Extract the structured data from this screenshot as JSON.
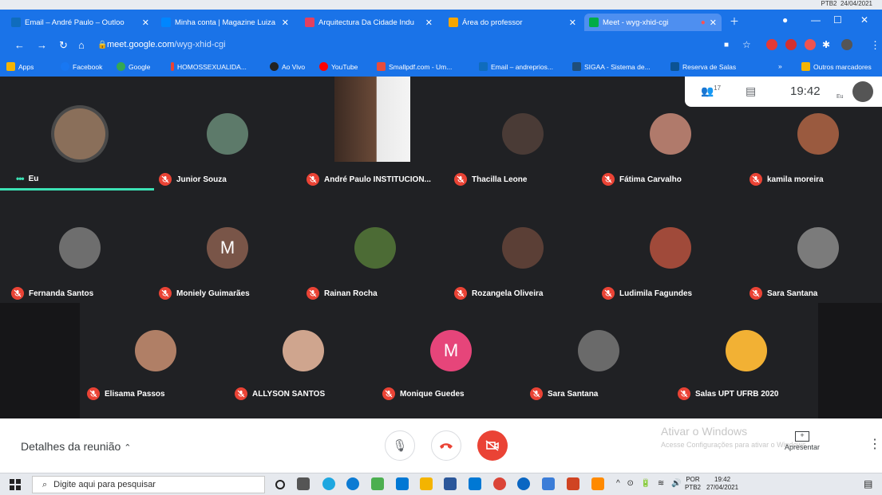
{
  "browser": {
    "tabs": [
      {
        "label": "Email – André Paulo – Outloo",
        "favicon_color": "#0f6cbd"
      },
      {
        "label": "Minha conta | Magazine Luiza",
        "favicon_color": "#0086ff"
      },
      {
        "label": "Arquitectura Da Cidade Indu",
        "favicon_color": "#e4405f"
      },
      {
        "label": "Área do professor",
        "favicon_color": "#f7a600"
      },
      {
        "label": "Meet - wyg-xhid-cgi",
        "favicon_color": "#00ac47"
      }
    ],
    "url_domain": "meet.google.com",
    "url_path": "/wyg-xhid-cgi",
    "bookmarks": [
      {
        "label": "Apps",
        "color": "#f4b400"
      },
      {
        "label": "Facebook",
        "color": "#1877f2"
      },
      {
        "label": "Google",
        "color": "#34a853"
      },
      {
        "label": "HOMOSSEXUALIDA...",
        "color": "#ea4335"
      },
      {
        "label": "Ao Vivo",
        "color": "#222222"
      },
      {
        "label": "YouTube",
        "color": "#ff0000"
      },
      {
        "label": "Smallpdf.com - Um...",
        "color": "#e74c3c"
      },
      {
        "label": "Email – andreprios...",
        "color": "#0f6cbd"
      },
      {
        "label": "SIGAA - Sistema de...",
        "color": "#1f4e79"
      },
      {
        "label": "Reserva de Salas",
        "color": "#0b5394"
      },
      {
        "label": "Outros marcadores",
        "color": "#f4b400"
      }
    ]
  },
  "top_tray": {
    "lang": "PTB2",
    "date": "24/04/2021"
  },
  "meet": {
    "participant_count": "17",
    "time": "19:42",
    "self_label": "Eu",
    "participants": [
      {
        "name": "Eu",
        "avatar_color": "#8a6f5a",
        "muted": false,
        "speaking": true
      },
      {
        "name": "Junior Souza",
        "avatar_color": "#5d7a6a",
        "muted": true
      },
      {
        "name": "André Paulo INSTITUCION...",
        "avatar_color": "#a67b5b",
        "muted": true,
        "video": true
      },
      {
        "name": "Thacilla Leone",
        "avatar_color": "#4a3b36",
        "muted": true
      },
      {
        "name": "Fátima Carvalho",
        "avatar_color": "#b07a6b",
        "muted": true
      },
      {
        "name": "kamila moreira",
        "avatar_color": "#9a5a3f",
        "muted": true
      },
      {
        "name": "Fernanda Santos",
        "avatar_color": "#6e6e6e",
        "muted": true
      },
      {
        "name": "Moniely Guimarães",
        "avatar_color": "#795548",
        "muted": true,
        "initial": "M"
      },
      {
        "name": "Rainan Rocha",
        "avatar_color": "#4c6b35",
        "muted": true
      },
      {
        "name": "Rozangela Oliveira",
        "avatar_color": "#5b3f36",
        "muted": true
      },
      {
        "name": "Ludimila Fagundes",
        "avatar_color": "#a04a3a",
        "muted": true
      },
      {
        "name": "Sara Santana",
        "avatar_color": "#7b7b7b",
        "muted": true
      },
      {
        "name": "Elisama Passos",
        "avatar_color": "#b07f66",
        "muted": true
      },
      {
        "name": "ALLYSON SANTOS",
        "avatar_color": "#cfa58e",
        "muted": true
      },
      {
        "name": "Monique Guedes",
        "avatar_color": "#e6457a",
        "muted": true,
        "initial": "M"
      },
      {
        "name": "Sara Santana",
        "avatar_color": "#6a6a6a",
        "muted": true
      },
      {
        "name": "Salas UPT UFRB 2020",
        "avatar_color": "#f2b134",
        "muted": true
      }
    ],
    "meeting_details_label": "Detalhes da reunião",
    "present_label": "Apresentar"
  },
  "activation": {
    "title": "Ativar o Windows",
    "subtitle": "Acesse Configurações para ativar o Windows."
  },
  "taskbar": {
    "search_placeholder": "Digite aqui para pesquisar",
    "lang_line1": "POR",
    "lang_line2": "PTB2",
    "time": "19:42",
    "date": "27/04/2021"
  }
}
